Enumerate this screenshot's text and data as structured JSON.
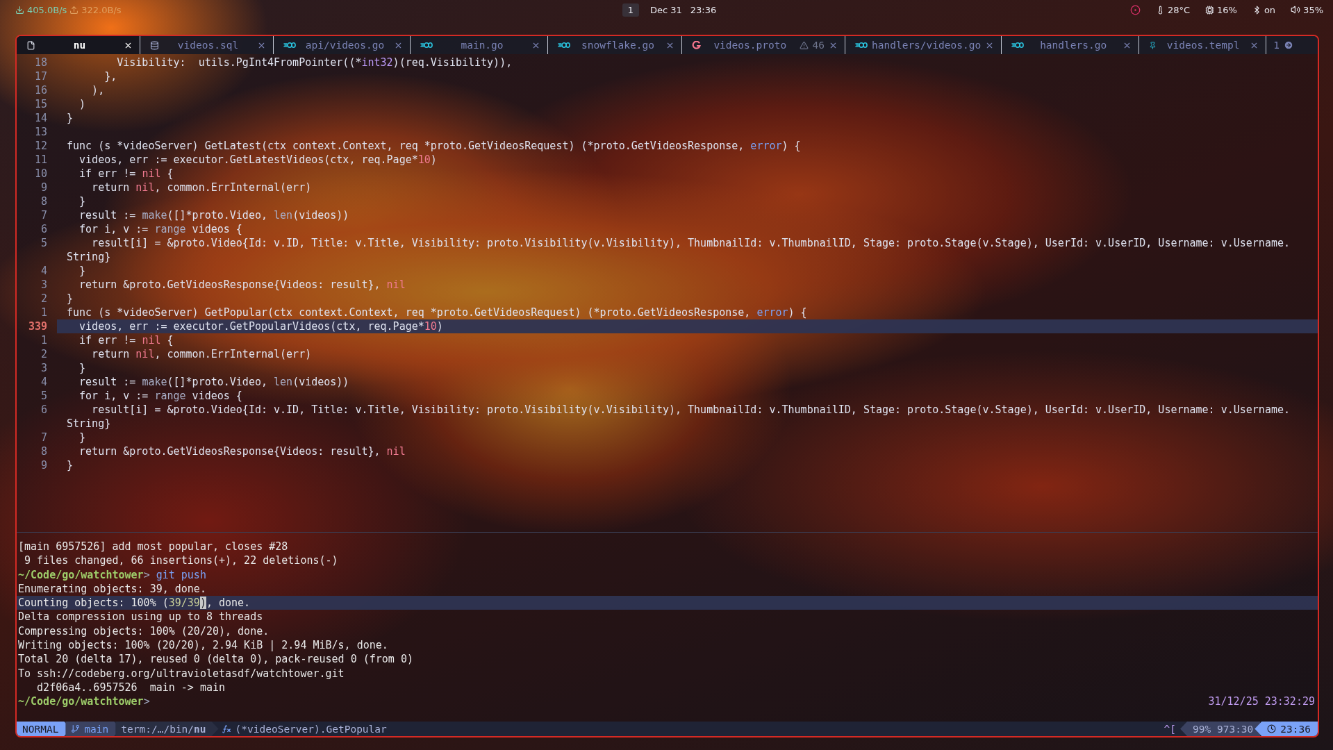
{
  "topbar": {
    "download": "405.0B/s",
    "upload": "322.0B/s",
    "workspace": "1",
    "date": "Dec 31",
    "time": "23:36",
    "temperature": "28°C",
    "cpu": "16%",
    "bluetooth": "on",
    "volume": "35%"
  },
  "tabs": [
    {
      "label": "nu",
      "kind": "file",
      "selected": true
    },
    {
      "label": "videos.sql",
      "kind": "database",
      "selected": false
    },
    {
      "label": "api/videos.go",
      "kind": "go",
      "selected": false
    },
    {
      "label": "main.go",
      "kind": "go",
      "selected": false
    },
    {
      "label": "snowflake.go",
      "kind": "go",
      "selected": false
    },
    {
      "label": "videos.proto",
      "kind": "proto",
      "selected": false,
      "warnings": "46"
    },
    {
      "label": "handlers/videos.go",
      "kind": "go",
      "selected": false
    },
    {
      "label": "handlers.go",
      "kind": "go",
      "selected": false
    },
    {
      "label": "videos.templ",
      "kind": "templ",
      "selected": false
    }
  ],
  "tab_overflow": "1",
  "code_lines": [
    {
      "n": "18",
      "current": false,
      "segments": [
        {
          "text": "        Visibility:  utils.PgInt4FromPointer((*",
          "kind": "plain"
        },
        {
          "text": "int32",
          "kind": "type"
        },
        {
          "text": ")(req.Visibility)),",
          "kind": "plain"
        }
      ]
    },
    {
      "n": "17",
      "current": false,
      "segments": [
        {
          "text": "      },",
          "kind": "plain"
        }
      ]
    },
    {
      "n": "16",
      "current": false,
      "segments": [
        {
          "text": "    ),",
          "kind": "plain"
        }
      ]
    },
    {
      "n": "15",
      "current": false,
      "segments": [
        {
          "text": "  )",
          "kind": "plain"
        }
      ]
    },
    {
      "n": "14",
      "current": false,
      "segments": [
        {
          "text": "}",
          "kind": "plain"
        }
      ]
    },
    {
      "n": "13",
      "current": false
    },
    {
      "n": "12",
      "current": false,
      "segments": [
        {
          "text": "func (s *videoServer) GetLatest(ctx context.Context, req *proto.GetVideosRequest) (*proto.GetVideosResponse, ",
          "kind": "plain"
        },
        {
          "text": "error",
          "kind": "error"
        },
        {
          "text": ") {",
          "kind": "plain"
        }
      ]
    },
    {
      "n": "11",
      "current": false,
      "segments": [
        {
          "text": "  videos, err := executor.GetLatestVideos(ctx, req.Page*",
          "kind": "plain"
        },
        {
          "text": "10",
          "kind": "const"
        },
        {
          "text": ")",
          "kind": "plain"
        }
      ]
    },
    {
      "n": "10",
      "current": false,
      "segments": [
        {
          "text": "  if err != ",
          "kind": "plain"
        },
        {
          "text": "nil",
          "kind": "const"
        },
        {
          "text": " {",
          "kind": "plain"
        }
      ]
    },
    {
      "n": "9",
      "current": false,
      "segments": [
        {
          "text": "    return ",
          "kind": "plain"
        },
        {
          "text": "nil",
          "kind": "const"
        },
        {
          "text": ", common.ErrInternal(err)",
          "kind": "plain"
        }
      ]
    },
    {
      "n": "8",
      "current": false,
      "segments": [
        {
          "text": "  }",
          "kind": "plain"
        }
      ]
    },
    {
      "n": "7",
      "current": false,
      "segments": [
        {
          "text": "  result := ",
          "kind": "plain"
        },
        {
          "text": "make",
          "kind": "builtin"
        },
        {
          "text": "([]*proto.Video, ",
          "kind": "plain"
        },
        {
          "text": "len",
          "kind": "builtin"
        },
        {
          "text": "(videos))",
          "kind": "plain"
        }
      ]
    },
    {
      "n": "6",
      "current": false,
      "segments": [
        {
          "text": "  for i, v := ",
          "kind": "plain"
        },
        {
          "text": "range",
          "kind": "builtin"
        },
        {
          "text": " videos {",
          "kind": "plain"
        }
      ]
    },
    {
      "n": "5",
      "current": false,
      "segments": [
        {
          "text": "    result[i] = &proto.Video{Id: v.ID, Title: v.Title, Visibility: proto.Visibility(v.Visibility), ThumbnailId: v.ThumbnailID, Stage: proto.Stage(v.Stage), UserId: v.UserID, Username: v.Username.",
          "kind": "plain"
        }
      ],
      "continuation": "String}"
    },
    {
      "n": "4",
      "current": false,
      "segments": [
        {
          "text": "  }",
          "kind": "plain"
        }
      ]
    },
    {
      "n": "3",
      "current": false,
      "segments": [
        {
          "text": "  return &proto.GetVideosResponse{Videos: result}, ",
          "kind": "plain"
        },
        {
          "text": "nil",
          "kind": "const"
        }
      ]
    },
    {
      "n": "2",
      "current": false,
      "segments": [
        {
          "text": "}",
          "kind": "plain"
        }
      ]
    },
    {
      "n": "1",
      "current": false,
      "segments": [
        {
          "text": "func (s *videoServer) GetPopular(ctx context.Context, req *proto.GetVideosRequest) (*proto.GetVideosResponse, ",
          "kind": "plain"
        },
        {
          "text": "error",
          "kind": "error"
        },
        {
          "text": ") {",
          "kind": "plain"
        }
      ]
    },
    {
      "n": "339",
      "current": true,
      "segments": [
        {
          "text": "  videos, err := executor.GetPopularVideos(ctx, req.Page*",
          "kind": "plain"
        },
        {
          "text": "10",
          "kind": "const"
        },
        {
          "text": ")",
          "kind": "plain"
        }
      ]
    },
    {
      "n": "1",
      "current": false,
      "segments": [
        {
          "text": "  if err != ",
          "kind": "plain"
        },
        {
          "text": "nil",
          "kind": "const"
        },
        {
          "text": " {",
          "kind": "plain"
        }
      ]
    },
    {
      "n": "2",
      "current": false,
      "segments": [
        {
          "text": "    return ",
          "kind": "plain"
        },
        {
          "text": "nil",
          "kind": "const"
        },
        {
          "text": ", common.ErrInternal(err)",
          "kind": "plain"
        }
      ]
    },
    {
      "n": "3",
      "current": false,
      "segments": [
        {
          "text": "  }",
          "kind": "plain"
        }
      ]
    },
    {
      "n": "4",
      "current": false,
      "segments": [
        {
          "text": "  result := ",
          "kind": "plain"
        },
        {
          "text": "make",
          "kind": "builtin"
        },
        {
          "text": "([]*proto.Video, ",
          "kind": "plain"
        },
        {
          "text": "len",
          "kind": "builtin"
        },
        {
          "text": "(videos))",
          "kind": "plain"
        }
      ]
    },
    {
      "n": "5",
      "current": false,
      "segments": [
        {
          "text": "  for i, v := ",
          "kind": "plain"
        },
        {
          "text": "range",
          "kind": "builtin"
        },
        {
          "text": " videos {",
          "kind": "plain"
        }
      ]
    },
    {
      "n": "6",
      "current": false,
      "segments": [
        {
          "text": "    result[i] = &proto.Video{Id: v.ID, Title: v.Title, Visibility: proto.Visibility(v.Visibility), ThumbnailId: v.ThumbnailID, Stage: proto.Stage(v.Stage), UserId: v.UserID, Username: v.Username.",
          "kind": "plain"
        }
      ],
      "continuation": "String}"
    },
    {
      "n": "7",
      "current": false,
      "segments": [
        {
          "text": "  }",
          "kind": "plain"
        }
      ]
    },
    {
      "n": "8",
      "current": false,
      "segments": [
        {
          "text": "  return &proto.GetVideosResponse{Videos: result}, ",
          "kind": "plain"
        },
        {
          "text": "nil",
          "kind": "const"
        }
      ]
    },
    {
      "n": "9",
      "current": false,
      "segments": [
        {
          "text": "}",
          "kind": "plain"
        }
      ]
    }
  ],
  "terminal_lines": [
    {
      "highlighted": false,
      "segments": [
        {
          "text": "[main 6957526] add most popular, closes #28",
          "kind": "plain"
        }
      ]
    },
    {
      "highlighted": false,
      "segments": [
        {
          "text": " 9 files changed, 66 insertions(+), 22 deletions(-)",
          "kind": "plain"
        }
      ]
    },
    {
      "highlighted": false,
      "segments": [
        {
          "text": "~/Code/go/watchtower",
          "kind": "path"
        },
        {
          "text": "> ",
          "kind": "prompt"
        },
        {
          "text": "git push",
          "kind": "command"
        }
      ]
    },
    {
      "highlighted": false,
      "segments": [
        {
          "text": "Enumerating objects: 39, done.",
          "kind": "plain"
        }
      ]
    },
    {
      "highlighted": true,
      "segments": [
        {
          "text": "Counting objects: 100% (",
          "kind": "plain"
        },
        {
          "text": "39/39",
          "kind": "number"
        },
        {
          "text": ")",
          "kind": "cursor"
        },
        {
          "text": ", done.",
          "kind": "plain"
        }
      ]
    },
    {
      "highlighted": false,
      "segments": [
        {
          "text": "Delta compression using up to 8 threads",
          "kind": "plain"
        }
      ]
    },
    {
      "highlighted": false,
      "segments": [
        {
          "text": "Compressing objects: 100% (20/20), done.",
          "kind": "plain"
        }
      ]
    },
    {
      "highlighted": false,
      "segments": [
        {
          "text": "Writing objects: 100% (20/20), 2.94 KiB | 2.94 MiB/s, done.",
          "kind": "plain"
        }
      ]
    },
    {
      "highlighted": false,
      "segments": [
        {
          "text": "Total 20 (delta 17), reused 0 (delta 0), pack-reused 0 (from 0)",
          "kind": "plain"
        }
      ]
    },
    {
      "highlighted": false,
      "segments": [
        {
          "text": "To ssh://codeberg.org/ultravioletasdf/watchtower.git",
          "kind": "plain"
        }
      ]
    },
    {
      "highlighted": false,
      "segments": [
        {
          "text": "   d2f06a4..6957526  main -> main",
          "kind": "plain"
        }
      ]
    },
    {
      "highlighted": false,
      "segments": [
        {
          "text": "~/Code/go/watchtower",
          "kind": "path"
        },
        {
          "text": ">",
          "kind": "prompt"
        }
      ],
      "timestamp": "31/12/25 23:32:29"
    }
  ],
  "statusline": {
    "mode": "NORMAL",
    "branch": "main",
    "terminal": "term:/…/bin/**nu**",
    "function": "(*videoServer).GetPopular",
    "keys": "^[",
    "position": "99% 973:30",
    "time": "23:36"
  }
}
